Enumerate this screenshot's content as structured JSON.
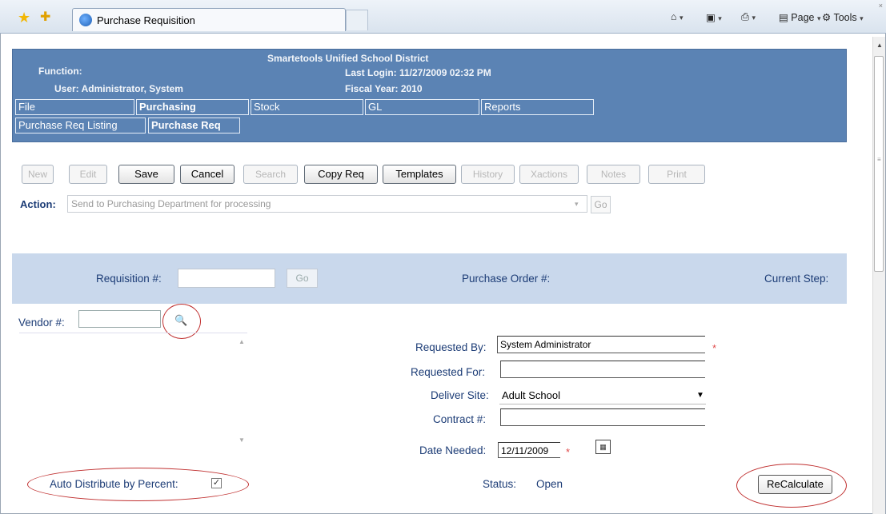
{
  "browser": {
    "tab_title": "Purchase Requisition",
    "cmd_page": "Page",
    "cmd_tools": "Tools",
    "caret": "▾"
  },
  "header": {
    "district": "Smartetools Unified School District",
    "function_label": "Function:",
    "last_login": "Last Login: 11/27/2009 02:32 PM",
    "user": "User: Administrator, System",
    "fiscal_year": "Fiscal Year: 2010",
    "menu": [
      "File",
      "Purchasing",
      "Stock",
      "GL",
      "Reports"
    ],
    "submenu": [
      "Purchase Req Listing",
      "Purchase Req"
    ]
  },
  "toolbar": {
    "new": "New",
    "edit": "Edit",
    "save": "Save",
    "cancel": "Cancel",
    "search": "Search",
    "copy_req": "Copy Req",
    "templates": "Templates",
    "history": "History",
    "xactions": "Xactions",
    "notes": "Notes",
    "print": "Print"
  },
  "action": {
    "label": "Action:",
    "value": "Send to Purchasing Department for processing",
    "go": "Go"
  },
  "requisition": {
    "label": "Requisition #:",
    "value": "",
    "go": "Go",
    "po_label": "Purchase Order #:",
    "current_step_label": "Current Step:"
  },
  "vendor": {
    "label": "Vendor #:",
    "value": ""
  },
  "form": {
    "requested_by_label": "Requested By:",
    "requested_by": "System Administrator",
    "requested_for_label": "Requested For:",
    "requested_for": "",
    "deliver_site_label": "Deliver Site:",
    "deliver_site": "Adult School",
    "contract_label": "Contract #:",
    "contract": "",
    "date_needed_label": "Date Needed:",
    "date_needed": "12/11/2009",
    "required_mark": "*"
  },
  "bottom": {
    "auto_distribute_label": "Auto Distribute by Percent:",
    "auto_distribute_checked": true,
    "status_label": "Status:",
    "status_value": "Open",
    "recalculate": "ReCalculate"
  },
  "colors": {
    "header_bg": "#5b83b4",
    "band_bg": "#c9d8ec",
    "label_text": "#1c3c76",
    "annotation_circle": "#c03030",
    "required": "#e04848"
  }
}
